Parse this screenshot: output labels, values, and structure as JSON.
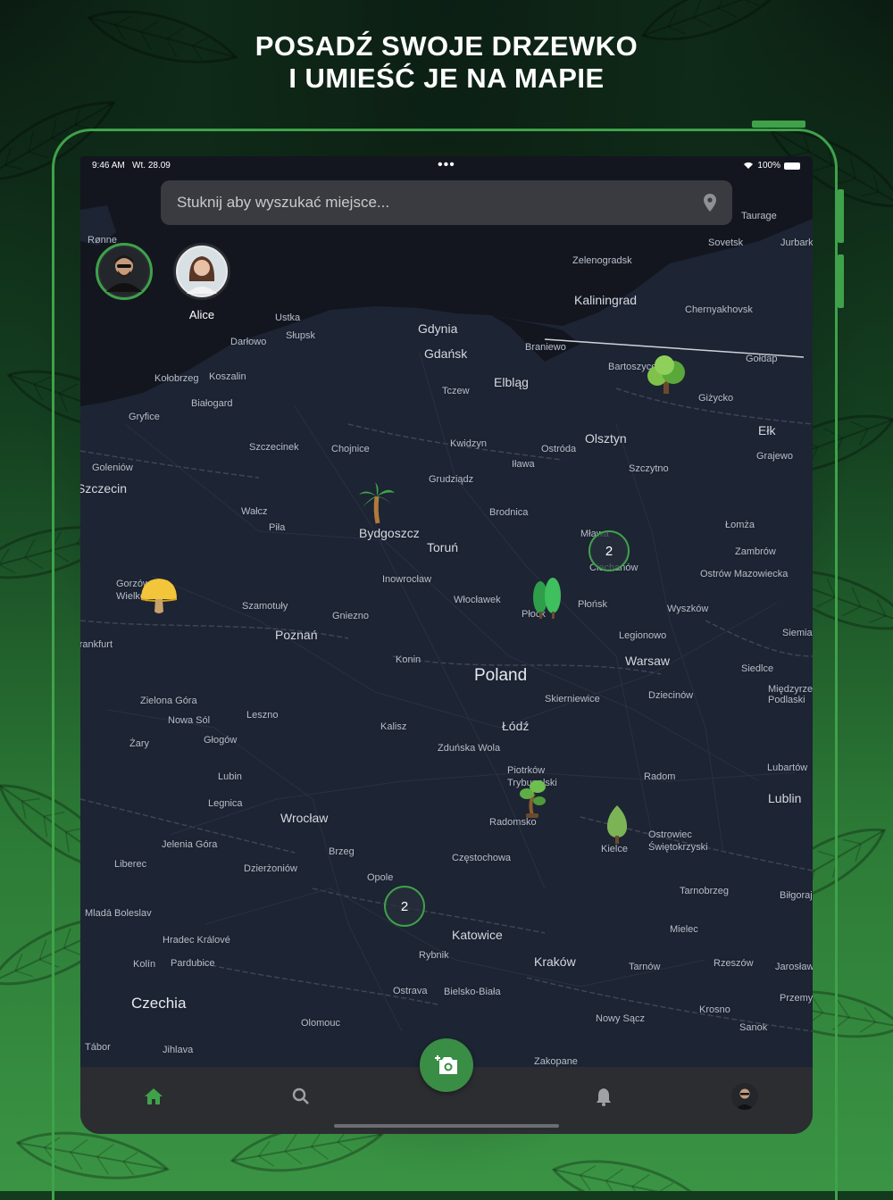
{
  "promo": {
    "line1": "POSADŹ SWOJE DRZEWKO",
    "line2": "I UMIEŚĆ JE NA MAPIE"
  },
  "status_bar": {
    "time": "9:46 AM",
    "date": "Wt. 28.09",
    "battery": "100%"
  },
  "search": {
    "placeholder": "Stuknij aby wyszukać miejsce...",
    "icon": "location-pin-icon"
  },
  "stories": [
    {
      "name": ""
    },
    {
      "name": "Alice"
    }
  ],
  "map": {
    "country_label": "Poland",
    "cities": [
      "Rønne",
      "Ustka",
      "Słupsk",
      "Darłowo",
      "Gdynia",
      "Gdańsk",
      "Kołobrzeg",
      "Koszalin",
      "Białogard",
      "Gryfice",
      "Tczew",
      "Elbląg",
      "Braniewo",
      "Zelenogradsk",
      "Kaliningrad",
      "Chernyakhovsk",
      "Sovetsk",
      "Taurage",
      "Jurbark",
      "Bartoszyce",
      "Gołdap",
      "Giżycko",
      "Ełk",
      "Grajewo",
      "Olsztyn",
      "Ostróda",
      "Iława",
      "Szczytno",
      "Kwidzyn",
      "Chojnice",
      "Szczecinek",
      "Goleniów",
      "Szczecin",
      "Wałcz",
      "Piła",
      "Bydgoszcz",
      "Toruń",
      "Grudziądz",
      "Brodnica",
      "Mława",
      "Ciechanów",
      "Łomża",
      "Zambrów",
      "Ostrów Mazowiecka",
      "Gorzów Wielkopolski",
      "Inowrocław",
      "Włocławek",
      "Płock",
      "Płońsk",
      "Wyszków",
      "Szamotuły",
      "Gniezno",
      "Poznań",
      "Konin",
      "Legionowo",
      "Warsaw",
      "Siedlce",
      "Zielona Góra",
      "Nowa Sól",
      "Leszno",
      "Kalisz",
      "Łódź",
      "Skierniewice",
      "Dziecinów",
      "Żary",
      "Głogów",
      "Lubin",
      "Zduńska Wola",
      "Piotrków Trybunalski",
      "Radom",
      "Legnica",
      "Wrocław",
      "Radomsko",
      "Kielce",
      "Ostrowiec Świętokrzyski",
      "Lublin",
      "Lubartów",
      "Jelenia Góra",
      "Brzeg",
      "Częstochowa",
      "Liberec",
      "Dzierżoniów",
      "Opole",
      "Tarnobrzeg",
      "Biłgoraj",
      "Mladá Boleslav",
      "Hradec Králové",
      "Mielec",
      "Katowice",
      "Kolín",
      "Pardubice",
      "Rybnik",
      "Kraków",
      "Tarnów",
      "Rzeszów",
      "Jarosław",
      "Ostrava",
      "Bielsko-Biała",
      "Czechia",
      "Przemyśl",
      "Olomouc",
      "Nowy Sącz",
      "Krosno",
      "Sanok",
      "Tábor",
      "Jihlava",
      "Zakopane",
      "Frankfurt",
      "Międzyrzec Podlaski",
      "Siemiatycze"
    ],
    "clusters": [
      "2",
      "2"
    ],
    "trees": [
      "oak-tree",
      "palm-tree",
      "cypress-trees",
      "mushroom-tree",
      "bonsai-tree",
      "poplar-tree"
    ]
  },
  "tabbar": {
    "items": [
      "home-icon",
      "search-icon",
      "camera-add-icon",
      "bell-icon",
      "profile-avatar"
    ],
    "active_color": "#3fa24a"
  }
}
